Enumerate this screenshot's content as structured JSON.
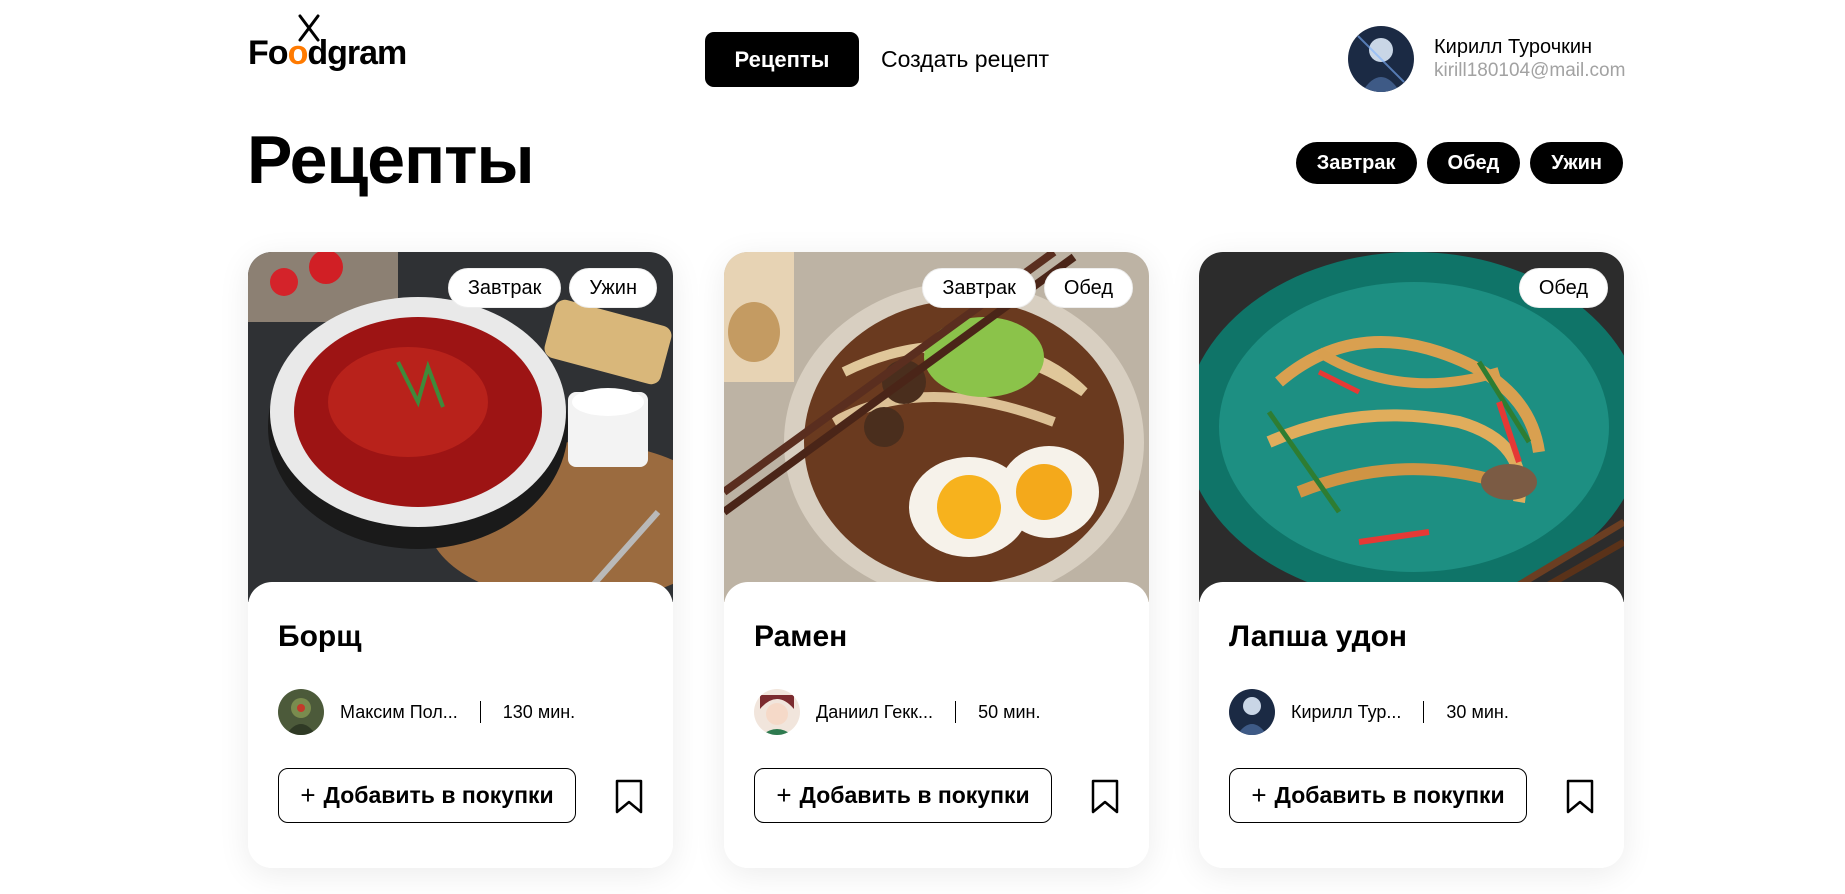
{
  "header": {
    "logo_text_pre": "F",
    "logo_text_o1": "o",
    "logo_text_o2": "o",
    "logo_text_post": "dgram",
    "nav": {
      "recipes_label": "Рецепты",
      "create_label": "Создать рецепт"
    },
    "user": {
      "name": "Кирилл Турочкин",
      "email": "kirill180104@mail.com"
    }
  },
  "page": {
    "title": "Рецепты",
    "filters": [
      "Завтрак",
      "Обед",
      "Ужин"
    ]
  },
  "colors": {
    "accent": "#ff7a00",
    "primary": "#000000",
    "muted": "#a2a2a2"
  },
  "recipes": [
    {
      "title": "Борщ",
      "tags": [
        "Завтрак",
        "Ужин"
      ],
      "author": "Максим Пол...",
      "time": "130 мин.",
      "add_label": "Добавить в покупки",
      "add_icon": "+"
    },
    {
      "title": "Рамен",
      "tags": [
        "Завтрак",
        "Обед"
      ],
      "author": "Даниил Гекк...",
      "time": "50 мин.",
      "add_label": "Добавить в покупки",
      "add_icon": "+"
    },
    {
      "title": "Лапша удон",
      "tags": [
        "Обед"
      ],
      "author": "Кирилл Тур...",
      "time": "30 мин.",
      "add_label": "Добавить в покупки",
      "add_icon": "+"
    }
  ]
}
